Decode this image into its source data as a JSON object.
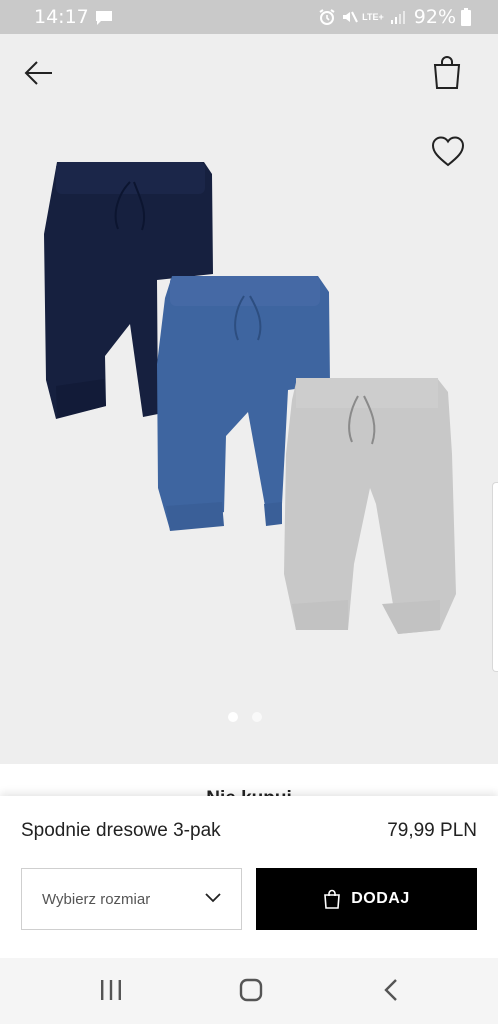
{
  "status_bar": {
    "time": "14:17",
    "network_label": "LTE+",
    "battery_percent": "92%"
  },
  "hero": {
    "icons": [
      "back-arrow-icon",
      "shopping-bag-icon",
      "heart-icon"
    ],
    "image_count": 2,
    "active_image": 1
  },
  "section": {
    "peek_title": "Nie kupuj"
  },
  "product": {
    "name": "Spodnie dresowe 3-pak",
    "price": "79,99 PLN"
  },
  "size_select": {
    "label": "Wybierz rozmiar"
  },
  "add_button": {
    "label": "DODAJ"
  },
  "colors": {
    "status_bar": "#c9c9c9",
    "hero_bg": "#eeeeee",
    "add_button_bg": "#000000",
    "pants_navy": "#16203f",
    "pants_blue": "#3e65a0",
    "pants_grey": "#c8c8c8"
  }
}
